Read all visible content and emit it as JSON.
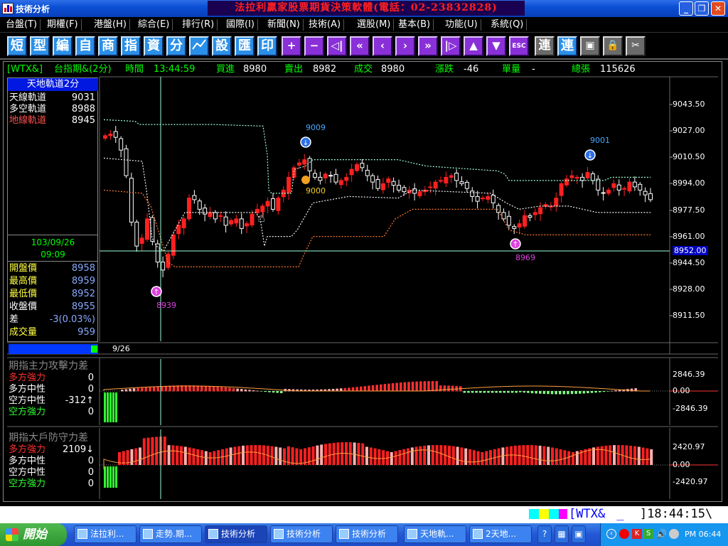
{
  "window": {
    "title": "技術分析",
    "banner": "法拉利贏家股票期貨決策軟體(電話：02-23832828)"
  },
  "menu": [
    "台盤(T)",
    "期權(F)",
    "港盤(H)",
    "綜合(E)",
    "排行(R)",
    "國際(I)",
    "新聞(N)",
    "技術(A)",
    "選股(M)",
    "基本(B)",
    "功能(U)",
    "系統(Q)"
  ],
  "toolbar": {
    "char_buttons": [
      "短",
      "型",
      "編",
      "自",
      "商",
      "指",
      "資",
      "分"
    ],
    "char_buttons2": [
      "設",
      "匯",
      "印"
    ],
    "icons": [
      "chart-icon",
      "plus-icon",
      "minus-icon",
      "first-icon",
      "rewind-icon",
      "prev-icon",
      "next-icon",
      "fast-forward-icon",
      "last-icon",
      "up-icon",
      "down-icon",
      "esc-icon",
      "link-icon",
      "link2-icon",
      "window-icon",
      "lock-icon",
      "tools-icon"
    ],
    "esc_label": "ESC",
    "link1": "連",
    "link2": "連"
  },
  "quote": {
    "symbol": "[WTX&]",
    "name": "台指期&(2分)",
    "time_label": "時間",
    "time": "13:44:59",
    "bid_label": "買進",
    "bid": "8980",
    "ask_label": "賣出",
    "ask": "8982",
    "trade_label": "成交",
    "trade": "8980",
    "change_label": "漲跌",
    "change": "-46",
    "vol_label": "單量",
    "vol": "-",
    "total_label": "總張",
    "total": "115626"
  },
  "left_panel": {
    "header": "天地軌道2分",
    "tracks": [
      {
        "label": "天線軌道",
        "value": "9031",
        "color": "#ffffff"
      },
      {
        "label": "多空軌道",
        "value": "8988",
        "color": "#ffffff"
      },
      {
        "label": "地線軌道",
        "value": "8945",
        "color": "#ff5050"
      }
    ],
    "date": "103/09/26",
    "time": "09:09",
    "stats": [
      {
        "label": "開盤價",
        "value": "8958"
      },
      {
        "label": "最高價",
        "value": "8959"
      },
      {
        "label": "最低價",
        "value": "8952"
      },
      {
        "label": "收盤價",
        "value": "8955"
      },
      {
        "label": "差",
        "value": "-3(0.03%)"
      },
      {
        "label": "成交量",
        "value": "959"
      }
    ]
  },
  "price_axis": [
    "9043.50",
    "9027.00",
    "9010.50",
    "8994.00",
    "8977.50",
    "8961.00",
    "8944.50",
    "8928.00",
    "8911.50"
  ],
  "crosshair_price": "8952.00",
  "date_label": "9/26",
  "markers": {
    "high1": "9009",
    "mid": "9000",
    "low1": "8939",
    "high2": "9001",
    "low2": "8969"
  },
  "panel1": {
    "title": "期指主力攻擊力差",
    "rows": [
      {
        "label": "多方強力",
        "value": "0",
        "color": "#ff3030"
      },
      {
        "label": "多方中性",
        "value": "0",
        "color": "#ffffff"
      },
      {
        "label": "空方中性",
        "value": "-312↑",
        "color": "#ffffff"
      },
      {
        "label": "空方強力",
        "value": "0",
        "color": "#30ff30"
      }
    ],
    "axis": [
      "2846.39",
      "0.00",
      "-2846.39"
    ]
  },
  "panel2": {
    "title": "期指大戶防守力差",
    "rows": [
      {
        "label": "多方強力",
        "value": "2109↓",
        "color": "#ff3030"
      },
      {
        "label": "多方中性",
        "value": "0",
        "color": "#ffffff"
      },
      {
        "label": "空方中性",
        "value": "0",
        "color": "#ffffff"
      },
      {
        "label": "空方強力",
        "value": "0",
        "color": "#30ff30"
      }
    ],
    "axis": [
      "2420.97",
      "0.00",
      "-2420.97"
    ]
  },
  "status": {
    "ticker": "[WTX&",
    "time": "]18:44:15\\"
  },
  "taskbar": {
    "start": "開始",
    "tasks": [
      "法拉利...",
      "走勢.期...",
      "技術分析",
      "技術分析",
      "技術分析",
      "天地軌...",
      "2天地..."
    ],
    "clock": "PM 06:44"
  }
}
